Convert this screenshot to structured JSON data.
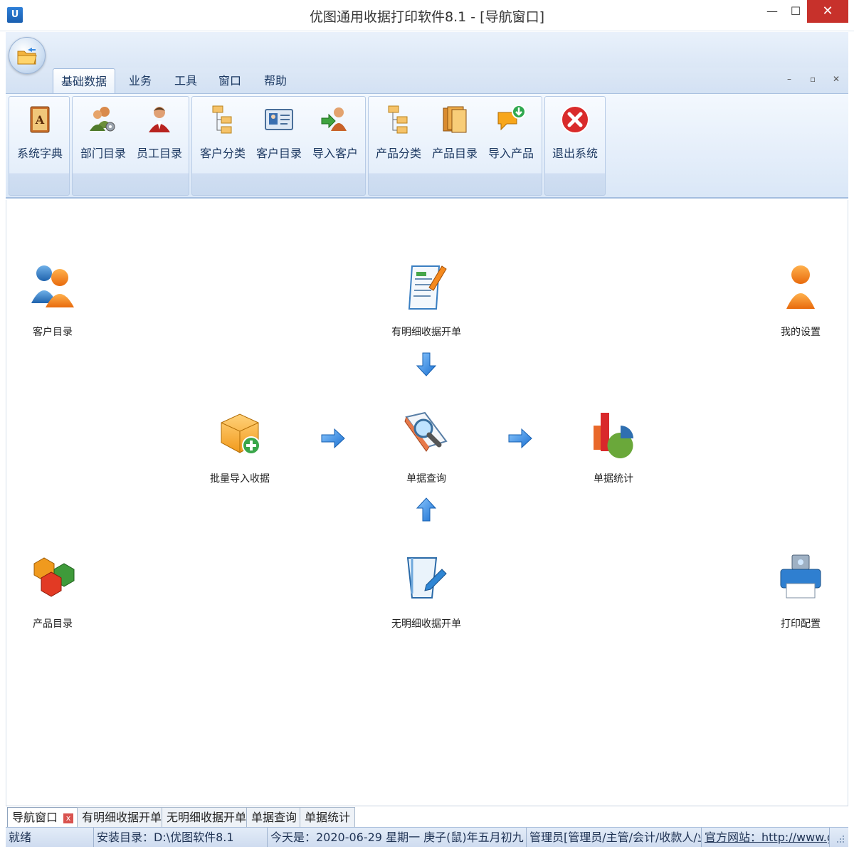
{
  "window": {
    "app_icon": "U",
    "title": "优图通用收据打印软件8.1 - [导航窗口]",
    "minimize_glyph": "—",
    "maximize_glyph": "☐",
    "close_glyph": "✕"
  },
  "ribbon": {
    "orb_icon": "open-folder-icon",
    "tabs": [
      {
        "label": "基础数据",
        "active": true
      },
      {
        "label": "业务"
      },
      {
        "label": "工具"
      },
      {
        "label": "窗口"
      },
      {
        "label": "帮助"
      }
    ],
    "mdi_controls": [
      "–",
      "▫",
      "✕"
    ],
    "groups": [
      {
        "buttons": [
          {
            "label": "系统字典",
            "icon": "dictionary-book-icon"
          }
        ]
      },
      {
        "buttons": [
          {
            "label": "部门目录",
            "icon": "department-users-gear-icon"
          },
          {
            "label": "员工目录",
            "icon": "employee-user-icon"
          }
        ]
      },
      {
        "buttons": [
          {
            "label": "客户分类",
            "icon": "customer-tree-icon"
          },
          {
            "label": "客户目录",
            "icon": "customer-card-icon"
          },
          {
            "label": "导入客户",
            "icon": "import-customer-icon"
          }
        ]
      },
      {
        "buttons": [
          {
            "label": "产品分类",
            "icon": "product-tree-icon"
          },
          {
            "label": "产品目录",
            "icon": "product-folders-icon"
          },
          {
            "label": "导入产品",
            "icon": "import-product-icon"
          }
        ]
      },
      {
        "buttons": [
          {
            "label": "退出系统",
            "icon": "exit-icon"
          }
        ]
      }
    ]
  },
  "nav": {
    "customer_catalog": "客户目录",
    "detailed_receipt": "有明细收据开单",
    "my_settings": "我的设置",
    "batch_import": "批量导入收据",
    "receipt_query": "单据查询",
    "receipt_stats": "单据统计",
    "product_catalog": "产品目录",
    "simple_receipt": "无明细收据开单",
    "print_config": "打印配置"
  },
  "mdi_tabs": [
    {
      "label": "导航窗口",
      "active": true,
      "close": "x"
    },
    {
      "label": "有明细收据开单"
    },
    {
      "label": "无明细收据开单"
    },
    {
      "label": "单据查询"
    },
    {
      "label": "单据统计"
    }
  ],
  "status": {
    "ready": "就绪",
    "install_dir": "安装目录：D:\\优图软件8.1",
    "today": "今天是：2020-06-29 星期一 庚子(鼠)年五月初九",
    "user": "管理员[管理员/主管/会计/收款人/业",
    "website": "官方网站：http://www.ghu"
  },
  "colors": {
    "accent": "#2d7fd8",
    "close_red": "#c7312b",
    "ribbon_text": "#1b3760"
  }
}
